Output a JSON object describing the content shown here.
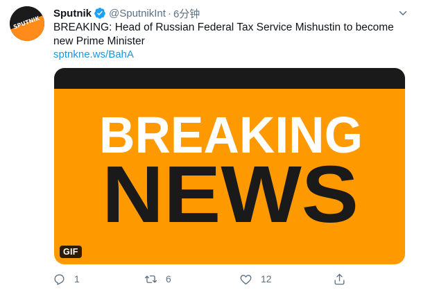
{
  "tweet": {
    "display_name": "Sputnik",
    "handle": "@SputnikInt",
    "separator": "·",
    "time": "6分钟",
    "text": "BREAKING: Head of Russian Federal Tax Service Mishustin to become new Prime Minister",
    "link": "sptnkne.ws/BahA",
    "avatar_label": "SPUTNIK",
    "media": {
      "line1": "BREAKING",
      "line2": "NEWS",
      "badge": "GIF",
      "background": "#ff9900"
    },
    "actions": {
      "reply_count": "1",
      "retweet_count": "6",
      "like_count": "12"
    }
  },
  "colors": {
    "accent": "#1b95e0",
    "muted": "#5b7083",
    "verified": "#1da1f2"
  }
}
